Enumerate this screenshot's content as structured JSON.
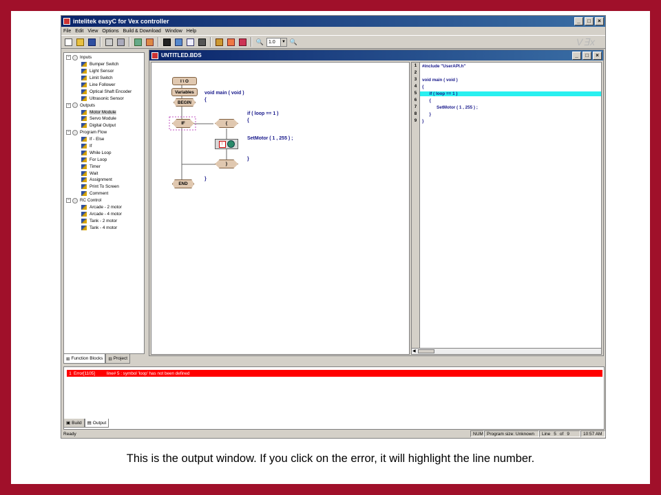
{
  "app": {
    "title": "intelitek easyC for Vex controller",
    "menu": [
      "File",
      "Edit",
      "View",
      "Options",
      "Build & Download",
      "Window",
      "Help"
    ],
    "zoom": "1.0",
    "logo": "VEX"
  },
  "left_panel": {
    "tree": [
      {
        "label": "Inputs",
        "type": "category",
        "items": [
          "Bumper Switch",
          "Light Sensor",
          "Limit Switch",
          "Line Follower",
          "Optical Shaft Encoder",
          "Ultrasonic Sensor"
        ]
      },
      {
        "label": "Outputs",
        "type": "category",
        "items": [
          "Motor Module",
          "Servo Module",
          "Digital Output"
        ]
      },
      {
        "label": "Program Flow",
        "type": "category",
        "items": [
          "If - Else",
          "If",
          "While Loop",
          "For Loop",
          "Timer",
          "Wait",
          "Assignment",
          "Print To Screen",
          "Comment"
        ]
      },
      {
        "label": "RC Control",
        "type": "category",
        "items": [
          "Arcade - 2 motor",
          "Arcade - 4 motor",
          "Tank - 2 motor",
          "Tank - 4 motor"
        ]
      }
    ],
    "selected_item": "Motor Module",
    "tabs": [
      "Function Blocks",
      "Project"
    ]
  },
  "document": {
    "title": "UNTITLED.BDS",
    "flow_blocks": {
      "io": "I \\ O",
      "variables": "Variables",
      "begin": "BEGIN",
      "if": "IF",
      "open_brace": "{",
      "close_brace": "}",
      "end": "END"
    },
    "flow_code": {
      "main": "void main ( void )",
      "main_open": "{",
      "if_line": "if ( loop == 1 )",
      "if_open": "{",
      "setmotor": "SetMotor ( 1 , 255 ) ;",
      "if_close": "}",
      "main_close": "}"
    },
    "code_lines": [
      {
        "num": "1",
        "text": "#include \"UserAPI.h\""
      },
      {
        "num": "2",
        "text": ""
      },
      {
        "num": "3",
        "text": "void main ( void )"
      },
      {
        "num": "4",
        "text": "{"
      },
      {
        "num": "5",
        "text": "      if ( loop == 1 )",
        "highlight": true
      },
      {
        "num": "6",
        "text": "      {"
      },
      {
        "num": "7",
        "text": "            SetMotor ( 1 , 255 ) ;"
      },
      {
        "num": "8",
        "text": "      }"
      },
      {
        "num": "9",
        "text": "}"
      }
    ]
  },
  "output": {
    "error": {
      "num": "1",
      "code": "Error[1105]",
      "message": "line# 5 : symbol 'loop' has not been defined"
    },
    "tabs": [
      "Build",
      "Output"
    ]
  },
  "status": {
    "ready": "Ready",
    "num": "NUM",
    "program_size": "Program size: Unknown",
    "line": "Line",
    "line_num": "5",
    "of": "of",
    "line_total": "9",
    "time": "10:57 AM"
  },
  "caption": "This is the output window. If you click on the error, it will highlight the line number.",
  "colors": {
    "frame": "#a0102a",
    "error_bg": "#ff0000",
    "highlight": "#29f0f0",
    "titlebar": "#0a246a"
  }
}
